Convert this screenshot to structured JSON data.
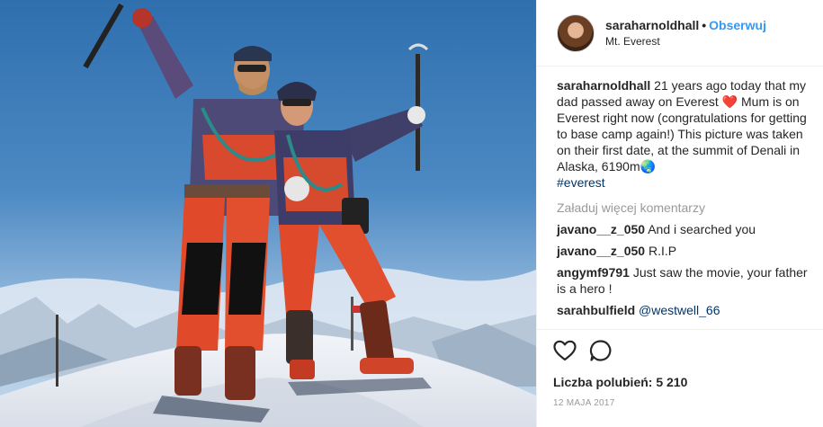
{
  "header": {
    "username": "saraharnoldhall",
    "separator": "•",
    "follow_label": "Obserwuj",
    "location": "Mt. Everest"
  },
  "caption": {
    "username": "saraharnoldhall",
    "text": "21 years ago today that my dad passed away on Everest ❤️ Mum is on Everest right now (congratulations for getting to base camp again!) This picture was taken on their first date, at the summit of Denali in Alaska, 6190m🌏",
    "hashtag": "#everest"
  },
  "load_more_label": "Załaduj więcej komentarzy",
  "comments": [
    {
      "username": "javano__z_050",
      "text": "And i searched you"
    },
    {
      "username": "javano__z_050",
      "text": "R.I.P"
    },
    {
      "username": "angymf9791",
      "text": "Just saw the movie, your father is a hero !"
    },
    {
      "username": "sarahbulfield",
      "text": "@westwell_66"
    }
  ],
  "likes_label": "Liczba polubień: 5 210",
  "date": "12 MAJA 2017",
  "icons": [
    "heart-icon",
    "comment-icon"
  ],
  "colors": {
    "link": "#3897f0",
    "hashtag": "#003569",
    "muted": "#999999"
  }
}
